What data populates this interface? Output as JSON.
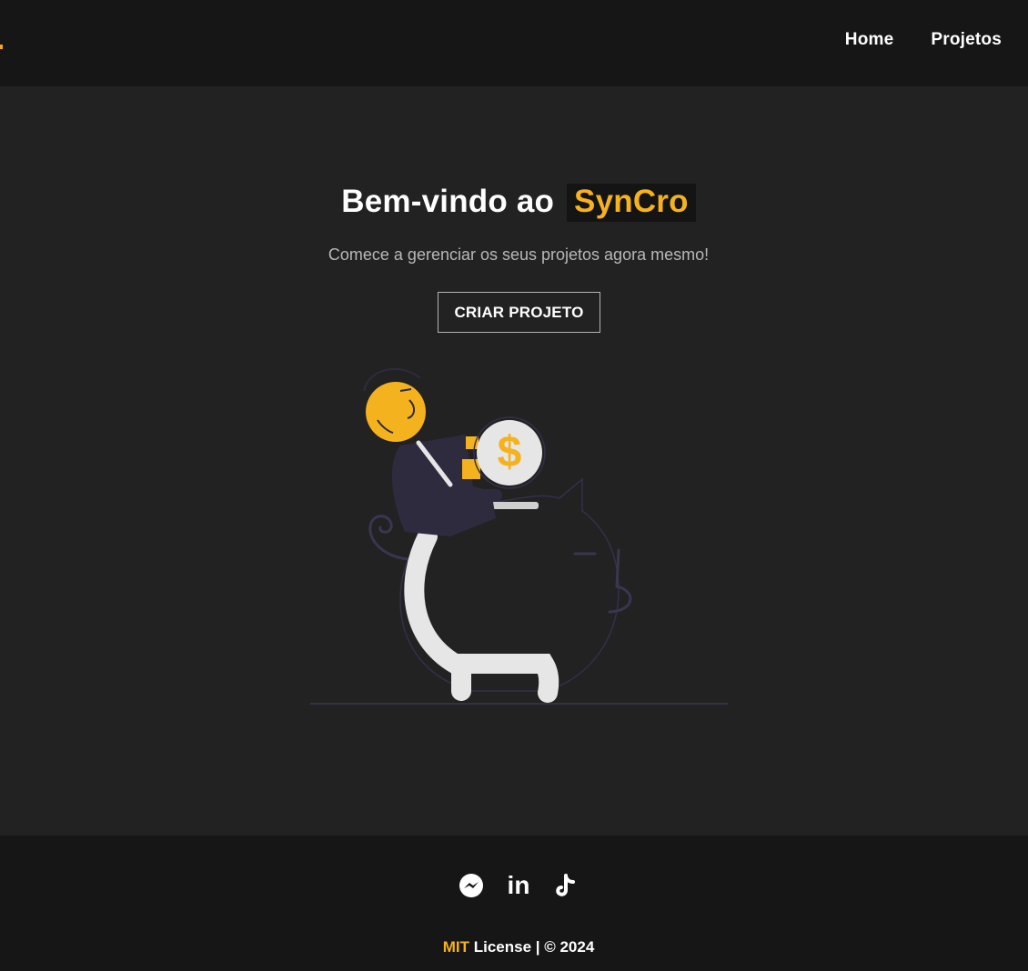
{
  "nav": {
    "links": [
      {
        "label": "Home"
      },
      {
        "label": "Projetos"
      }
    ]
  },
  "hero": {
    "title_prefix": "Bem-vindo ao",
    "brand": "SynCro",
    "subtitle": "Comece a gerenciar os seus projetos agora mesmo!",
    "cta_label": "CRIAR PROJETO",
    "coin_symbol": "$"
  },
  "footer": {
    "socials": [
      {
        "icon": "messenger-icon"
      },
      {
        "icon": "linkedin-icon",
        "text": "in"
      },
      {
        "icon": "tiktok-icon"
      }
    ],
    "license_accent": "MIT",
    "license_rest": " License | © 2024"
  },
  "colors": {
    "accent": "#f5b21f",
    "nav_bg": "#161616",
    "page_bg": "#222222",
    "figure_dark": "#2e2b3f",
    "pig_leg": "#e6e6e6"
  }
}
